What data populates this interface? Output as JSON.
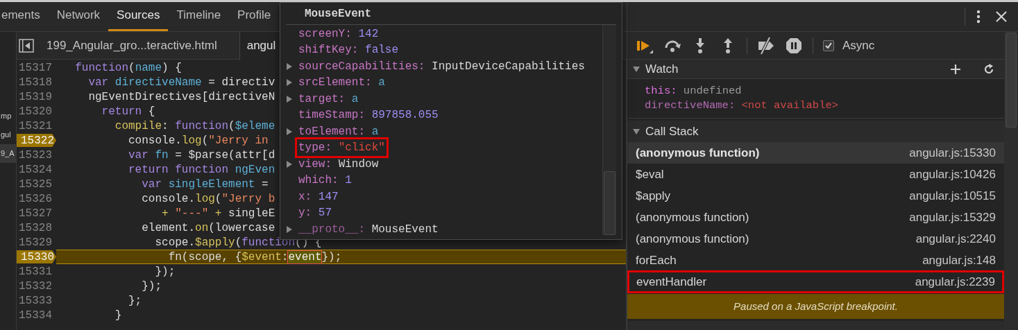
{
  "main_tabs": [
    {
      "label": "ements",
      "selected": false
    },
    {
      "label": "Network",
      "selected": false
    },
    {
      "label": "Sources",
      "selected": true
    },
    {
      "label": "Timeline",
      "selected": false
    },
    {
      "label": "Profile",
      "selected": false
    }
  ],
  "navigator": {
    "items": [
      {
        "label": "mp",
        "selected": false
      },
      {
        "label": "gul",
        "selected": false
      },
      {
        "label": "9_A",
        "selected": true
      }
    ]
  },
  "editor": {
    "file_tabs": [
      {
        "label": "199_Angular_gro...teractive.html",
        "selected": false
      },
      {
        "label": "angul",
        "selected": true
      }
    ],
    "lines": [
      {
        "number": "15317",
        "breakpoint": false,
        "current": false,
        "tokens": [
          {
            "kind": "keyword",
            "text": "  function"
          },
          {
            "kind": "plain",
            "text": "("
          },
          {
            "kind": "variable",
            "text": "name"
          },
          {
            "kind": "plain",
            "text": ") {"
          }
        ]
      },
      {
        "number": "15318",
        "breakpoint": false,
        "current": false,
        "tokens": [
          {
            "kind": "keyword",
            "text": "    var "
          },
          {
            "kind": "variable",
            "text": "directiveName"
          },
          {
            "kind": "plain",
            "text": " = directiv"
          }
        ]
      },
      {
        "number": "15319",
        "breakpoint": false,
        "current": false,
        "tokens": [
          {
            "kind": "plain",
            "text": "    ngEventDirectives[directiveN"
          }
        ]
      },
      {
        "number": "15320",
        "breakpoint": false,
        "current": false,
        "tokens": [
          {
            "kind": "keyword",
            "text": "      return"
          },
          {
            "kind": "plain",
            "text": " {"
          }
        ]
      },
      {
        "number": "15321",
        "breakpoint": false,
        "current": false,
        "tokens": [
          {
            "kind": "property",
            "text": "        compile"
          },
          {
            "kind": "plain",
            "text": ": "
          },
          {
            "kind": "keyword",
            "text": "function"
          },
          {
            "kind": "plain",
            "text": "("
          },
          {
            "kind": "variable",
            "text": "$eleme"
          }
        ]
      },
      {
        "number": "15322",
        "breakpoint": true,
        "current": false,
        "tokens": [
          {
            "kind": "plain",
            "text": "          console."
          },
          {
            "kind": "property",
            "text": "log"
          },
          {
            "kind": "plain",
            "text": "("
          },
          {
            "kind": "string",
            "text": "\"Jerry in"
          }
        ]
      },
      {
        "number": "15323",
        "breakpoint": false,
        "current": false,
        "tokens": [
          {
            "kind": "keyword",
            "text": "          var "
          },
          {
            "kind": "variable",
            "text": "fn"
          },
          {
            "kind": "plain",
            "text": " = $parse(attr[d"
          }
        ]
      },
      {
        "number": "15324",
        "breakpoint": false,
        "current": false,
        "tokens": [
          {
            "kind": "keyword",
            "text": "          return function "
          },
          {
            "kind": "variable",
            "text": "ngEven"
          }
        ]
      },
      {
        "number": "15325",
        "breakpoint": false,
        "current": false,
        "tokens": [
          {
            "kind": "keyword",
            "text": "            var "
          },
          {
            "kind": "variable",
            "text": "singleElement"
          },
          {
            "kind": "plain",
            "text": " ="
          }
        ]
      },
      {
        "number": "15326",
        "breakpoint": false,
        "current": false,
        "tokens": [
          {
            "kind": "plain",
            "text": "            console."
          },
          {
            "kind": "property",
            "text": "log"
          },
          {
            "kind": "plain",
            "text": "("
          },
          {
            "kind": "string",
            "text": "\"Jerry b"
          }
        ]
      },
      {
        "number": "15327",
        "breakpoint": false,
        "current": false,
        "tokens": [
          {
            "kind": "property",
            "text": "               + "
          },
          {
            "kind": "string",
            "text": "\"---\""
          },
          {
            "kind": "property",
            "text": " + "
          },
          {
            "kind": "plain",
            "text": "singleE"
          }
        ]
      },
      {
        "number": "15328",
        "breakpoint": false,
        "current": false,
        "tokens": [
          {
            "kind": "plain",
            "text": "            element."
          },
          {
            "kind": "property",
            "text": "on"
          },
          {
            "kind": "plain",
            "text": "(lowercase"
          }
        ]
      },
      {
        "number": "15329",
        "breakpoint": false,
        "current": false,
        "tokens": [
          {
            "kind": "plain",
            "text": "              scope."
          },
          {
            "kind": "property",
            "text": "$apply"
          },
          {
            "kind": "plain",
            "text": "("
          },
          {
            "kind": "keyword",
            "text": "function"
          },
          {
            "kind": "plain",
            "text": "() {"
          }
        ]
      },
      {
        "number": "15330",
        "breakpoint": true,
        "current": true,
        "tokens": [
          {
            "kind": "plain",
            "text": "                fn(scope, {"
          },
          {
            "kind": "property",
            "text": "$event"
          },
          {
            "kind": "plain",
            "text": ":"
          },
          {
            "kind": "hover",
            "text": "event"
          },
          {
            "kind": "plain",
            "text": "});"
          }
        ]
      },
      {
        "number": "15331",
        "breakpoint": false,
        "current": false,
        "tokens": [
          {
            "kind": "plain",
            "text": "              });"
          }
        ]
      },
      {
        "number": "15332",
        "breakpoint": false,
        "current": false,
        "tokens": [
          {
            "kind": "plain",
            "text": "            });"
          }
        ]
      },
      {
        "number": "15333",
        "breakpoint": false,
        "current": false,
        "tokens": [
          {
            "kind": "plain",
            "text": "          };"
          }
        ]
      },
      {
        "number": "15334",
        "breakpoint": false,
        "current": false,
        "tokens": [
          {
            "kind": "plain",
            "text": "        }"
          }
        ]
      }
    ]
  },
  "popover": {
    "title": "MouseEvent",
    "properties": [
      {
        "key": "screenY:",
        "value": "142",
        "kind": "number",
        "expandable": false,
        "outlined": false
      },
      {
        "key": "shiftKey:",
        "value": "false",
        "kind": "number",
        "expandable": false,
        "outlined": false
      },
      {
        "key": "sourceCapabilities:",
        "value": "InputDeviceCapabilities",
        "kind": "object",
        "expandable": true,
        "outlined": false
      },
      {
        "key": "srcElement:",
        "value": "a",
        "kind": "node",
        "expandable": true,
        "outlined": false
      },
      {
        "key": "target:",
        "value": "a",
        "kind": "node",
        "expandable": true,
        "outlined": false
      },
      {
        "key": "timeStamp:",
        "value": "897858.055",
        "kind": "number",
        "expandable": false,
        "outlined": false
      },
      {
        "key": "toElement:",
        "value": "a",
        "kind": "node",
        "expandable": true,
        "outlined": false
      },
      {
        "key": "type:",
        "value": "\"click\"",
        "kind": "string",
        "expandable": false,
        "outlined": true
      },
      {
        "key": "view:",
        "value": "Window",
        "kind": "object",
        "expandable": true,
        "outlined": false
      },
      {
        "key": "which:",
        "value": "1",
        "kind": "number",
        "expandable": false,
        "outlined": false
      },
      {
        "key": "x:",
        "value": "147",
        "kind": "number",
        "expandable": false,
        "outlined": false
      },
      {
        "key": "y:",
        "value": "57",
        "kind": "number",
        "expandable": false,
        "outlined": false
      },
      {
        "key": "__proto__:",
        "value": "MouseEvent",
        "kind": "object",
        "expandable": true,
        "outlined": false
      }
    ]
  },
  "debugger": {
    "async": {
      "label": "Async",
      "checked": true
    },
    "watch": {
      "title": "Watch",
      "expanded": true,
      "entries": [
        {
          "name": "this:",
          "value": "undefined",
          "kind": "value"
        },
        {
          "name": "directiveName:",
          "value": "<not available>",
          "kind": "error"
        }
      ]
    },
    "call_stack": {
      "title": "Call Stack",
      "expanded": true,
      "frames": [
        {
          "function": "(anonymous function)",
          "location": "angular.js:15330",
          "selected": true,
          "outlined": false
        },
        {
          "function": "$eval",
          "location": "angular.js:10426",
          "selected": false,
          "outlined": false
        },
        {
          "function": "$apply",
          "location": "angular.js:10515",
          "selected": false,
          "outlined": false
        },
        {
          "function": "(anonymous function)",
          "location": "angular.js:15329",
          "selected": false,
          "outlined": false
        },
        {
          "function": "(anonymous function)",
          "location": "angular.js:2240",
          "selected": false,
          "outlined": false
        },
        {
          "function": "forEach",
          "location": "angular.js:148",
          "selected": false,
          "outlined": false
        },
        {
          "function": "eventHandler",
          "location": "angular.js:2239",
          "selected": false,
          "outlined": true
        }
      ]
    },
    "status": "Paused on a JavaScript breakpoint."
  }
}
